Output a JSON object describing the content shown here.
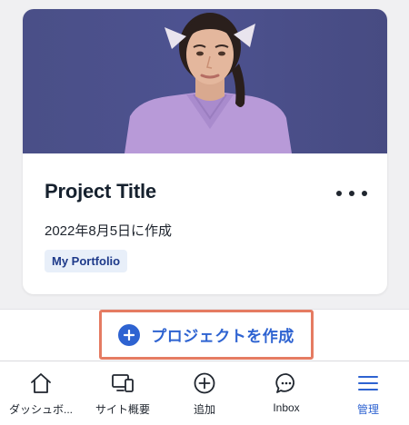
{
  "card": {
    "title": "Project Title",
    "created": "2022年8月5日に作成",
    "tag": "My Portfolio",
    "more_icon": "more-horizontal-icon"
  },
  "create_button": {
    "label": "プロジェクトを作成",
    "icon": "plus-circle-icon",
    "accent": "#2e63d1",
    "highlight_border": "#e57b62"
  },
  "tabbar": {
    "items": [
      {
        "label": "ダッシュボ...",
        "icon": "home-icon",
        "active": false
      },
      {
        "label": "サイト概要",
        "icon": "site-overview-icon",
        "active": false
      },
      {
        "label": "追加",
        "icon": "add-circle-icon",
        "active": false
      },
      {
        "label": "Inbox",
        "icon": "chat-bubble-icon",
        "active": false
      },
      {
        "label": "管理",
        "icon": "menu-icon",
        "active": true
      }
    ],
    "active_color": "#2e63d1"
  }
}
